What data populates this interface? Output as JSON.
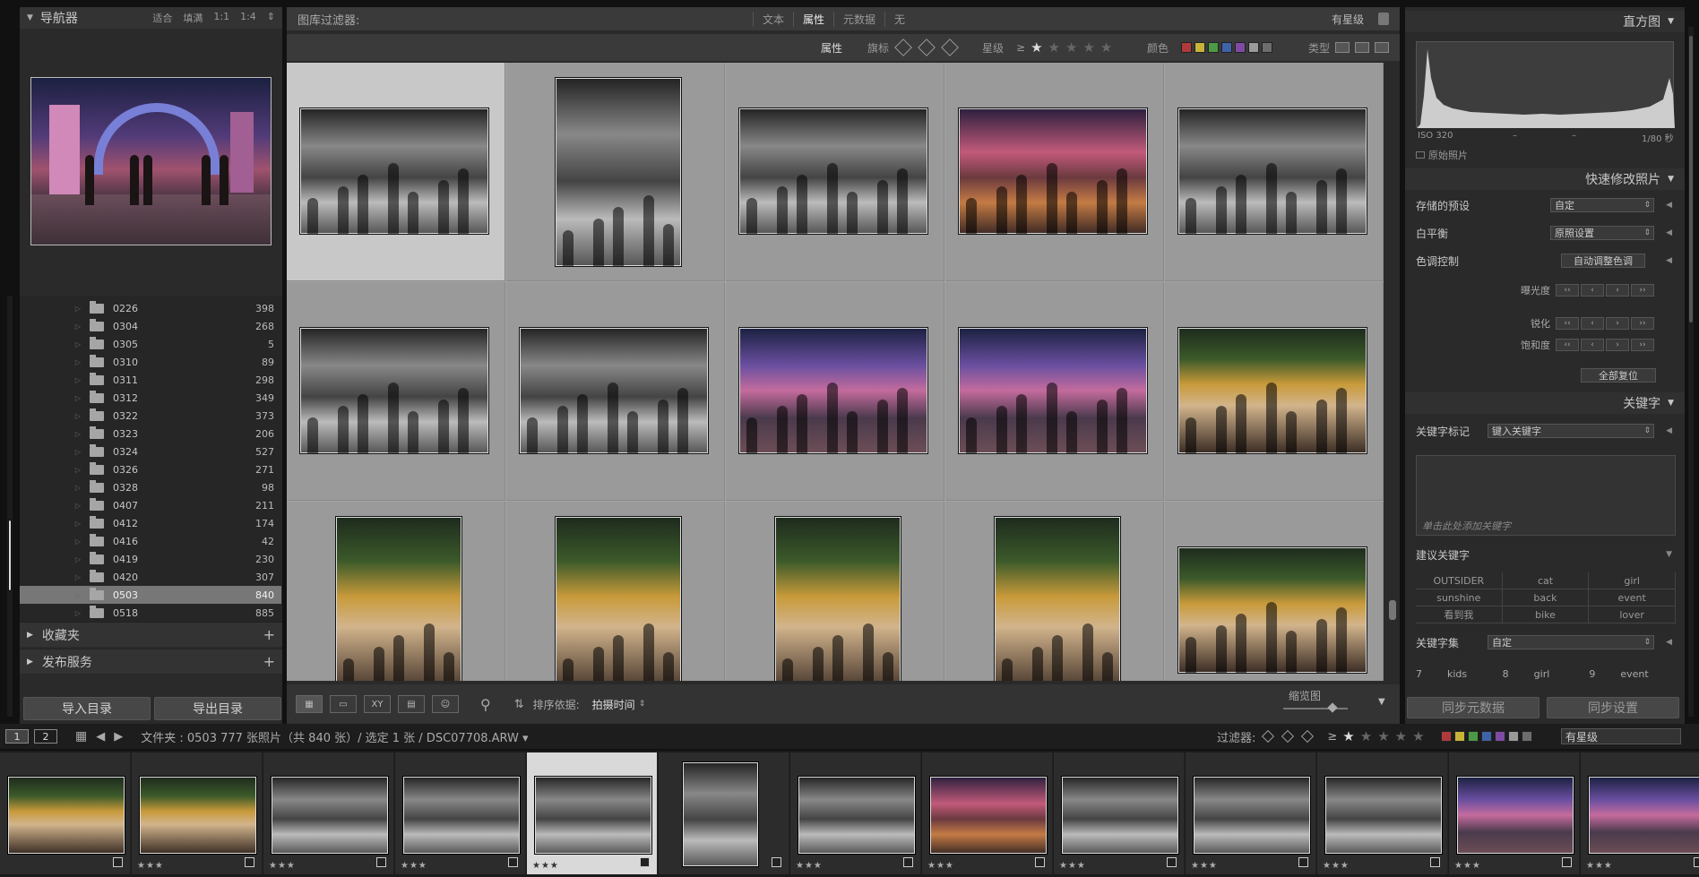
{
  "navigator": {
    "title": "导航器",
    "options": [
      "适合",
      "填满",
      "1:1",
      "1:4"
    ]
  },
  "folders": [
    {
      "name": "0226",
      "count": "398"
    },
    {
      "name": "0304",
      "count": "268"
    },
    {
      "name": "0305",
      "count": "5"
    },
    {
      "name": "0310",
      "count": "89"
    },
    {
      "name": "0311",
      "count": "298"
    },
    {
      "name": "0312",
      "count": "349"
    },
    {
      "name": "0322",
      "count": "373"
    },
    {
      "name": "0323",
      "count": "206"
    },
    {
      "name": "0324",
      "count": "527"
    },
    {
      "name": "0326",
      "count": "271"
    },
    {
      "name": "0328",
      "count": "98"
    },
    {
      "name": "0407",
      "count": "211"
    },
    {
      "name": "0412",
      "count": "174"
    },
    {
      "name": "0416",
      "count": "42"
    },
    {
      "name": "0419",
      "count": "230"
    },
    {
      "name": "0420",
      "count": "307"
    },
    {
      "name": "0503",
      "count": "840"
    },
    {
      "name": "0518",
      "count": "885"
    }
  ],
  "selected_folder": "0503",
  "left_sections": {
    "collections": "收藏夹",
    "publish": "发布服务"
  },
  "left_buttons": {
    "import": "导入目录",
    "export": "导出目录"
  },
  "filter": {
    "label": "图库过滤器:",
    "tabs": [
      "文本",
      "属性",
      "元数据",
      "无"
    ],
    "active_tab": "属性",
    "rating_select": "有星级",
    "attr_label": "属性",
    "flag_label": "旗标",
    "star_label": "星级",
    "ge": "≥",
    "color_label": "颜色",
    "type_label": "类型",
    "colors": [
      "#b03a3a",
      "#c8b33a",
      "#4c9a45",
      "#3f63a8",
      "#7f4aa4",
      "#9a9a9a",
      "#6d6d6d"
    ]
  },
  "toolbar": {
    "sort_label": "排序依据:",
    "sort_value": "拍摄时间",
    "thumb_label": "缩览图"
  },
  "right": {
    "histogram_title": "直方图",
    "iso": "ISO 320",
    "dash1": "–",
    "dash2": "–",
    "shutter": "1/80 秒",
    "original": "原始照片",
    "quick_develop": "快速修改照片",
    "saved_preset_label": "存储的预设",
    "saved_preset_value": "自定",
    "wb_label": "白平衡",
    "wb_value": "原照设置",
    "tone_label": "色调控制",
    "auto_tone": "自动调整色调",
    "exposure": "曝光度",
    "sharpen": "锐化",
    "saturation": "饱和度",
    "reset_all": "全部复位",
    "keywords_title": "关键字",
    "kw_tag_label": "关键字标记",
    "kw_tag_value": "键入关键字",
    "kw_hint": "单击此处添加关键字",
    "suggest_label": "建议关键字",
    "suggestions": [
      "OUTSIDER",
      "cat",
      "girl",
      "sunshine",
      "back",
      "event",
      "看到我",
      "bike",
      "lover"
    ],
    "kwset_label": "关键字集",
    "kwset_value": "自定",
    "kwset_items": [
      {
        "n": "7",
        "w": "kids"
      },
      {
        "n": "8",
        "w": "girl"
      },
      {
        "n": "9",
        "w": "event"
      }
    ],
    "sync_meta": "同步元数据",
    "sync_settings": "同步设置"
  },
  "status": {
    "page1": "1",
    "page2": "2",
    "folder_info": "文件夹 : 0503    777 张照片（共 840 张）/ 选定 1 张 / DSC07708.ARW ▾",
    "filter_label": "过滤器:",
    "ge": "≥",
    "rating_select": "有星级"
  },
  "film_stars": "★★★"
}
